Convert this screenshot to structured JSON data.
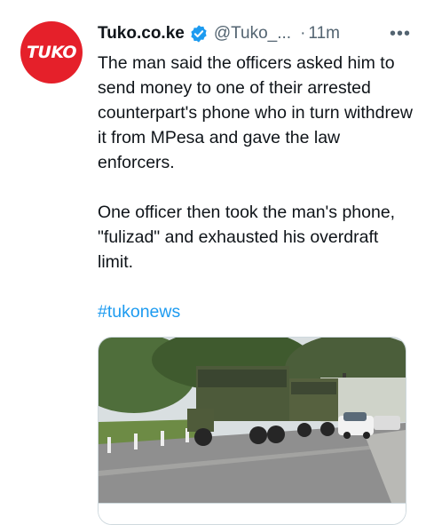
{
  "tweet": {
    "avatar_text": "TUKO",
    "display_name": "Tuko.co.ke",
    "handle": "@Tuko_...",
    "separator": "·",
    "time": "11m",
    "more_label": "•••",
    "paragraphs": [
      "The man said the officers asked him to send money to one of their arrested counterpart's phone who in turn withdrew it from MPesa and gave the law enforcers.",
      "One officer then took the man's phone, \"fulizad\" and exhausted his overdraft limit."
    ],
    "hashtag": "#tukonews"
  },
  "colors": {
    "brand_red": "#e5202a",
    "link_blue": "#1d9bf0",
    "verified_blue": "#1d9bf0",
    "secondary_text": "#536471"
  }
}
